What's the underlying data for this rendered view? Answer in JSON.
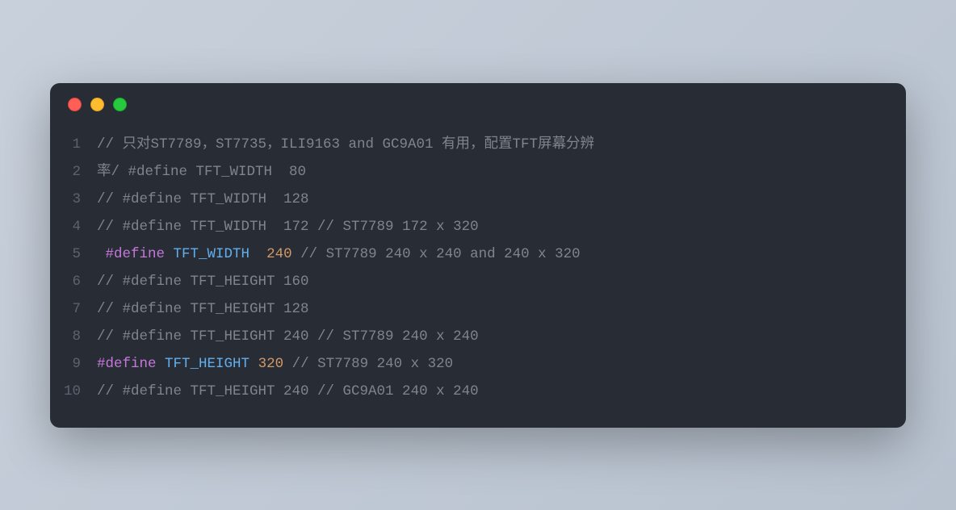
{
  "window": {
    "dots": [
      "red",
      "yellow",
      "green"
    ]
  },
  "colors": {
    "background": "#282c34",
    "comment": "#7f848e",
    "keyword": "#c678dd",
    "macroName": "#61afef",
    "number": "#d19a66",
    "lineNumber": "#5c6370"
  },
  "code": {
    "lines": [
      {
        "n": "1",
        "tokens": [
          {
            "t": "comment",
            "v": "// 只对ST7789，ST7735，ILI9163 and GC9A01 有用，配置TFT屏幕分辨"
          }
        ]
      },
      {
        "n": "2",
        "tokens": [
          {
            "t": "comment",
            "v": "率/ #define TFT_WIDTH  80"
          }
        ]
      },
      {
        "n": "3",
        "tokens": [
          {
            "t": "comment",
            "v": "// #define TFT_WIDTH  128"
          }
        ]
      },
      {
        "n": "4",
        "tokens": [
          {
            "t": "comment",
            "v": "// #define TFT_WIDTH  172 // ST7789 172 x 320"
          }
        ]
      },
      {
        "n": "5",
        "tokens": [
          {
            "t": "plain",
            "v": " "
          },
          {
            "t": "keyword",
            "v": "#define"
          },
          {
            "t": "plain",
            "v": " "
          },
          {
            "t": "macro-name",
            "v": "TFT_WIDTH"
          },
          {
            "t": "plain",
            "v": "  "
          },
          {
            "t": "number",
            "v": "240"
          },
          {
            "t": "plain",
            "v": " "
          },
          {
            "t": "comment",
            "v": "// ST7789 240 x 240 and 240 x 320"
          }
        ]
      },
      {
        "n": "6",
        "tokens": [
          {
            "t": "comment",
            "v": "// #define TFT_HEIGHT 160"
          }
        ]
      },
      {
        "n": "7",
        "tokens": [
          {
            "t": "comment",
            "v": "// #define TFT_HEIGHT 128"
          }
        ]
      },
      {
        "n": "8",
        "tokens": [
          {
            "t": "comment",
            "v": "// #define TFT_HEIGHT 240 // ST7789 240 x 240"
          }
        ]
      },
      {
        "n": "9",
        "tokens": [
          {
            "t": "keyword",
            "v": "#define"
          },
          {
            "t": "plain",
            "v": " "
          },
          {
            "t": "macro-name",
            "v": "TFT_HEIGHT"
          },
          {
            "t": "plain",
            "v": " "
          },
          {
            "t": "number",
            "v": "320"
          },
          {
            "t": "plain",
            "v": " "
          },
          {
            "t": "comment",
            "v": "// ST7789 240 x 320"
          }
        ]
      },
      {
        "n": "10",
        "tokens": [
          {
            "t": "comment",
            "v": "// #define TFT_HEIGHT 240 // GC9A01 240 x 240"
          }
        ]
      }
    ]
  }
}
